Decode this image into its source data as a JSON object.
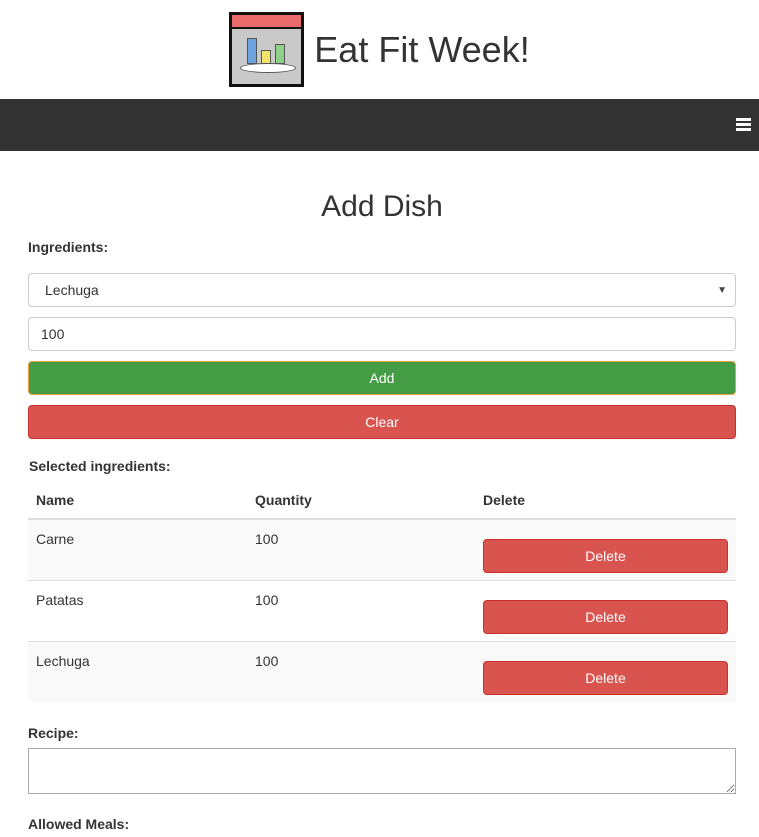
{
  "app": {
    "title": "Eat Fit Week!"
  },
  "navbar": {
    "menu_icon": "hamburger-menu-icon"
  },
  "page": {
    "heading": "Add Dish"
  },
  "ingredients": {
    "label": "Ingredients:",
    "selected_option": "Lechuga",
    "quantity_value": "100",
    "add_label": "Add",
    "clear_label": "Clear"
  },
  "selected": {
    "label": "Selected ingredients:",
    "headers": {
      "name": "Name",
      "quantity": "Quantity",
      "delete": "Delete"
    },
    "rows": [
      {
        "name": "Carne",
        "quantity": "100",
        "delete_label": "Delete"
      },
      {
        "name": "Patatas",
        "quantity": "100",
        "delete_label": "Delete"
      },
      {
        "name": "Lechuga",
        "quantity": "100",
        "delete_label": "Delete"
      }
    ]
  },
  "recipe": {
    "label": "Recipe:",
    "value": ""
  },
  "meals": {
    "label": "Allowed Meals:"
  },
  "colors": {
    "navbar": "#333333",
    "add": "#449d44",
    "danger": "#d9534f"
  }
}
